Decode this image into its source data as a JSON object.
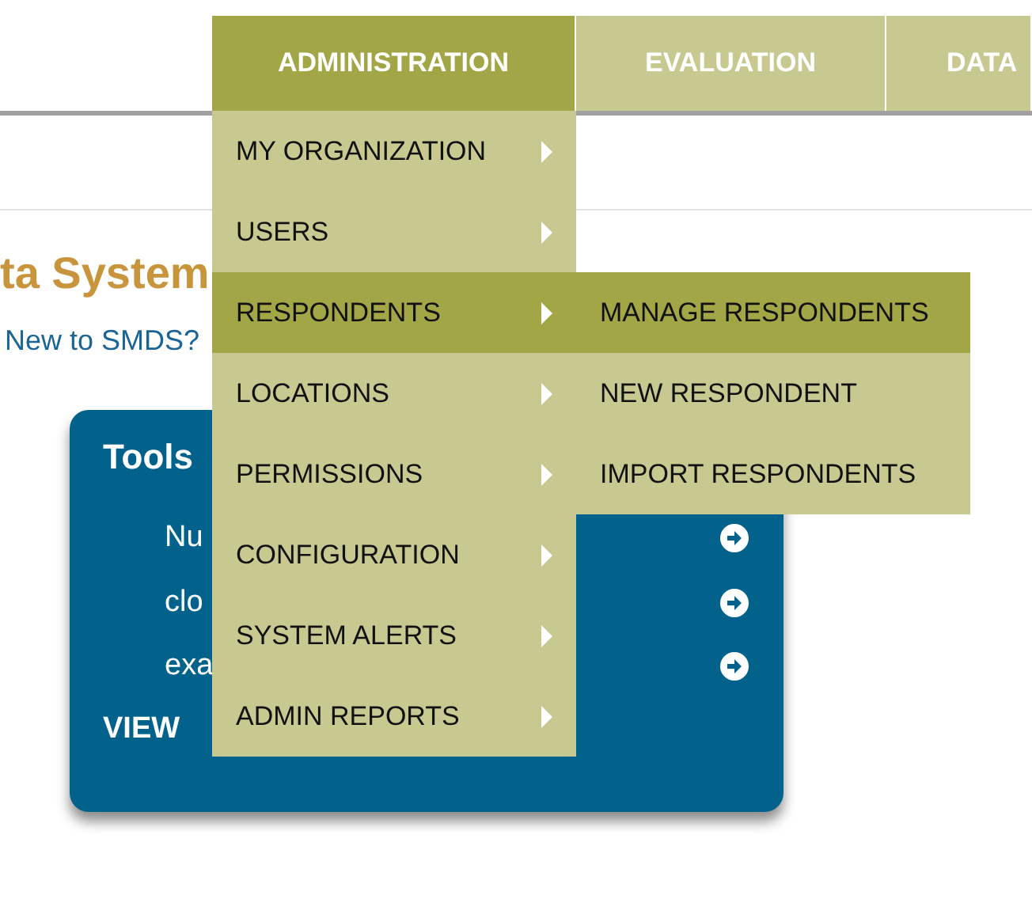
{
  "nav_tabs": [
    {
      "label": "ADMINISTRATION",
      "selected": true
    },
    {
      "label": "EVALUATION",
      "selected": false
    },
    {
      "label": "DATA",
      "selected": false
    }
  ],
  "heading": "ta System",
  "intro_link": "New to SMDS?",
  "tools_card": {
    "title": "Tools",
    "items": [
      "Nu",
      "clo",
      "exa"
    ],
    "footer_link": "VIEW"
  },
  "admin_menu": [
    {
      "label": "MY ORGANIZATION",
      "selected": false
    },
    {
      "label": "USERS",
      "selected": false
    },
    {
      "label": "RESPONDENTS",
      "selected": true
    },
    {
      "label": "LOCATIONS",
      "selected": false
    },
    {
      "label": "PERMISSIONS",
      "selected": false
    },
    {
      "label": "CONFIGURATION",
      "selected": false
    },
    {
      "label": "SYSTEM ALERTS",
      "selected": false
    },
    {
      "label": "ADMIN REPORTS",
      "selected": false
    }
  ],
  "respondents_submenu": [
    {
      "label": "MANAGE RESPONDENTS",
      "selected": true
    },
    {
      "label": "NEW RESPONDENT",
      "selected": false
    },
    {
      "label": "IMPORT RESPONDENTS",
      "selected": false
    }
  ]
}
